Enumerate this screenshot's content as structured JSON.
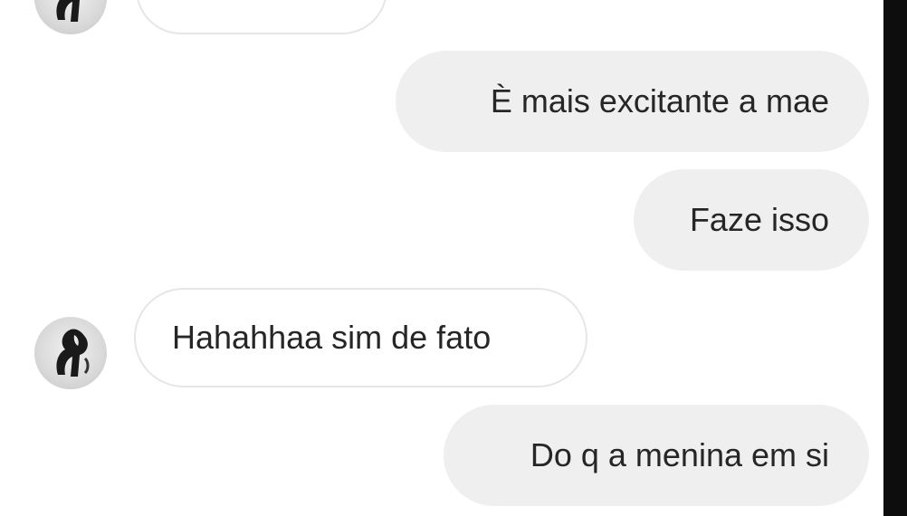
{
  "conversation": {
    "messages": [
      {
        "id": "m1",
        "direction": "incoming",
        "text": ""
      },
      {
        "id": "m2",
        "direction": "outgoing",
        "text": "È mais excitante a mae"
      },
      {
        "id": "m3",
        "direction": "outgoing",
        "text": "Faze isso"
      },
      {
        "id": "m4",
        "direction": "incoming",
        "text": "Hahahhaa sim de fato"
      },
      {
        "id": "m5",
        "direction": "outgoing",
        "text": "Do q a menina em si"
      }
    ]
  },
  "avatar_icon": "contact-avatar-icon",
  "colors": {
    "background": "#ffffff",
    "outgoing_bubble": "#efefef",
    "incoming_border": "#e6e6e6",
    "text": "#262626",
    "right_edge": "#0d0d0d"
  }
}
